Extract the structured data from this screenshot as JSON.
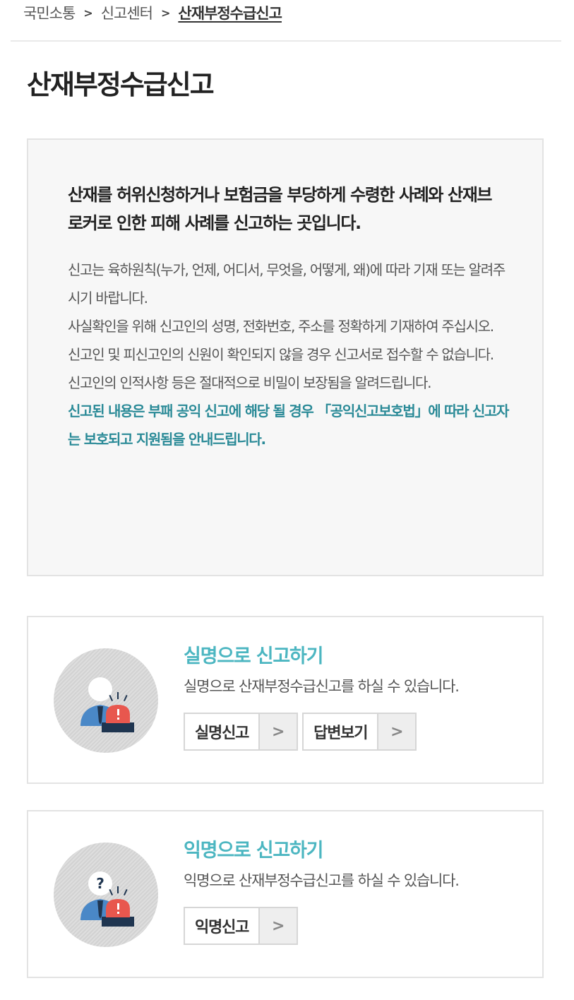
{
  "breadcrumb": {
    "items": [
      "국민소통",
      "신고센터",
      "산재부정수급신고"
    ],
    "separator": ">"
  },
  "page": {
    "title": "산재부정수급신고"
  },
  "info": {
    "heading": "산재를 허위신청하거나 보험금을 부당하게 수령한 사례와 산재브로커로 인한 피해 사례를 신고하는 곳입니다.",
    "paragraphs": [
      "신고는 육하원칙(누가, 언제, 어디서, 무엇을, 어떻게, 왜)에 따라 기재 또는 알려주시기 바랍니다.",
      "사실확인을 위해 신고인의 성명, 전화번호, 주소를 정확하게 기재하여 주십시오.",
      "신고인 및 피신고인의 신원이 확인되지 않을 경우 신고서로 접수할 수 없습니다.",
      "신고인의 인적사항 등은 절대적으로 비밀이 보장됨을 알려드립니다."
    ],
    "highlight": "신고된 내용은 부패 공익 신고에 해당 될 경우 「공익신고보호법」에 따라 신고자는 보호되고 지원됨을 안내드립니다.",
    "highlight_color": "#2a8a97"
  },
  "real_name_card": {
    "title": "실명으로 신고하기",
    "description": "실명으로 산재부정수급신고를 하실 수 있습니다.",
    "buttons": [
      "실명신고",
      "답변보기"
    ],
    "icon": "reporter-with-siren-icon"
  },
  "anonymous_card": {
    "title": "익명으로 신고하기",
    "description": "익명으로 산재부정수급신고를 하실 수 있습니다.",
    "buttons": [
      "익명신고"
    ],
    "icon": "anonymous-reporter-with-siren-icon"
  },
  "colors": {
    "accent": "#4cb6c1",
    "siren_red": "#e8574e",
    "siren_base": "#1f3550",
    "person_blue": "#4a88c7"
  },
  "icons": {
    "arrow": "chevron-right-icon"
  }
}
